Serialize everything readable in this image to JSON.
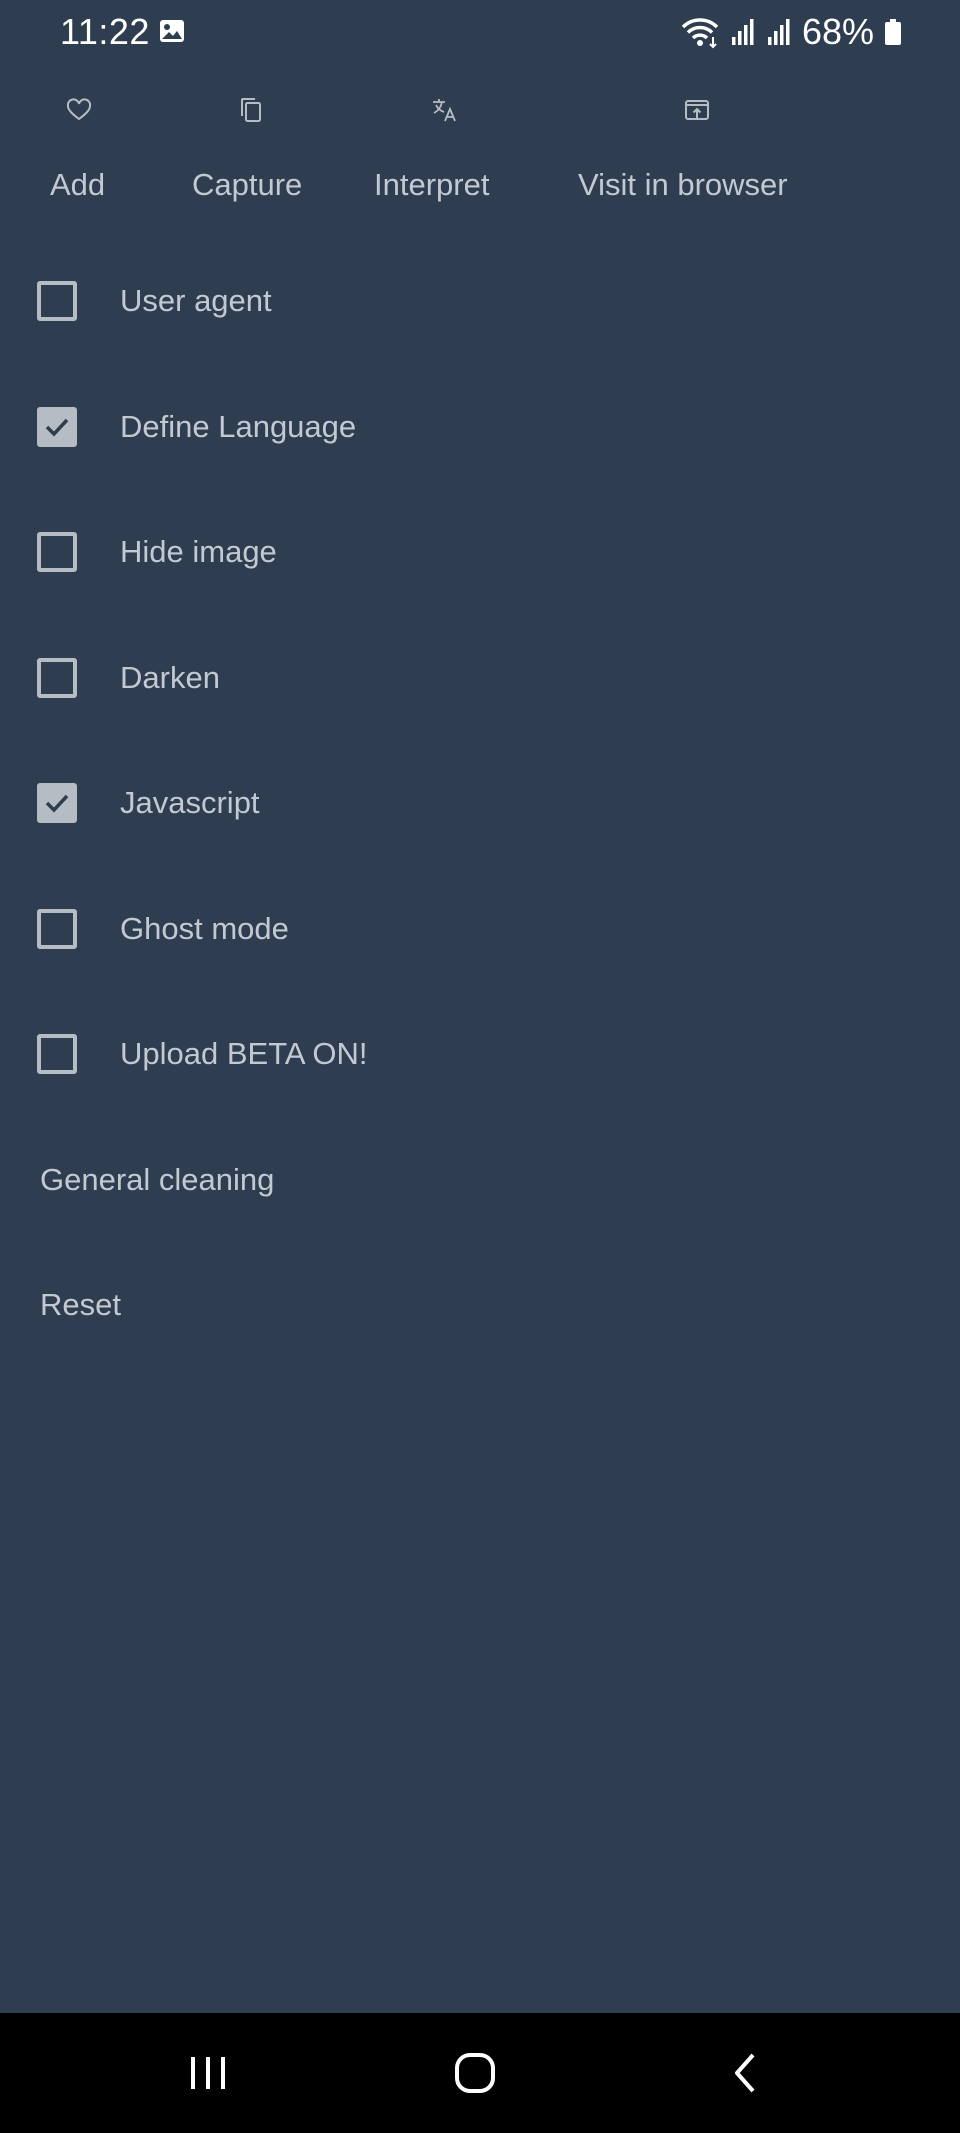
{
  "status_bar": {
    "time": "11:22",
    "battery": "68%",
    "icons": [
      "photo-icon",
      "wifi-icon",
      "signal-icon",
      "signal-icon",
      "battery-icon"
    ]
  },
  "toolbar": {
    "items": [
      {
        "label": "Add",
        "icon": "heart-icon"
      },
      {
        "label": "Capture",
        "icon": "copy-icon"
      },
      {
        "label": "Interpret",
        "icon": "translate-icon"
      },
      {
        "label": "Visit in browser",
        "icon": "open-in-browser-icon"
      }
    ]
  },
  "options": [
    {
      "label": "User agent",
      "checked": false
    },
    {
      "label": "Define Language",
      "checked": true
    },
    {
      "label": "Hide image",
      "checked": false
    },
    {
      "label": "Darken",
      "checked": false
    },
    {
      "label": "Javascript",
      "checked": true
    },
    {
      "label": "Ghost mode",
      "checked": false
    },
    {
      "label": "Upload BETA ON!",
      "checked": false
    }
  ],
  "actions": {
    "general_cleaning": "General cleaning",
    "reset": "Reset"
  },
  "nav_bar": {
    "icons": [
      "recent-apps-icon",
      "home-icon",
      "back-icon"
    ]
  },
  "colors": {
    "background": "#2e3d50",
    "text": "#c3c9d1",
    "checkbox": "#b6bcc4",
    "nav_bar": "#000000"
  }
}
